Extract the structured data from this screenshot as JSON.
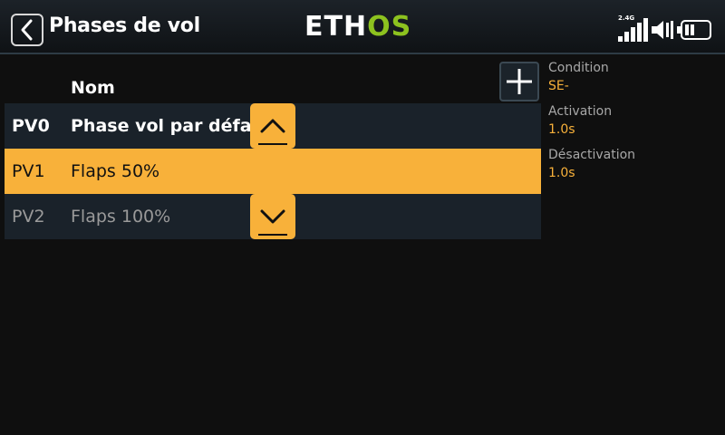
{
  "header": {
    "title": "Phases de vol",
    "logo_left": "ETH",
    "logo_right": "OS",
    "band": "2.4G"
  },
  "list": {
    "column_name": "Nom",
    "rows": [
      {
        "code": "PV0",
        "name": "Phase vol par défaut",
        "state": "normal"
      },
      {
        "code": "PV1",
        "name": "Flaps 50%",
        "state": "selected"
      },
      {
        "code": "PV2",
        "name": "Flaps 100%",
        "state": "dimmed"
      }
    ]
  },
  "properties": {
    "condition_label": "Condition",
    "condition_value": "SE-",
    "activation_label": "Activation",
    "activation_value": "1.0s",
    "deactivation_label": "Désactivation",
    "deactivation_value": "1.0s"
  },
  "colors": {
    "accent": "#f8b13a",
    "row_bg": "#1a222a",
    "background": "#0f0f0f",
    "logo_green": "#8dc21f"
  },
  "icons": [
    "back-icon",
    "plus-icon",
    "chevron-up-icon",
    "chevron-down-icon",
    "signal-icon",
    "speaker-icon",
    "battery-icon"
  ]
}
